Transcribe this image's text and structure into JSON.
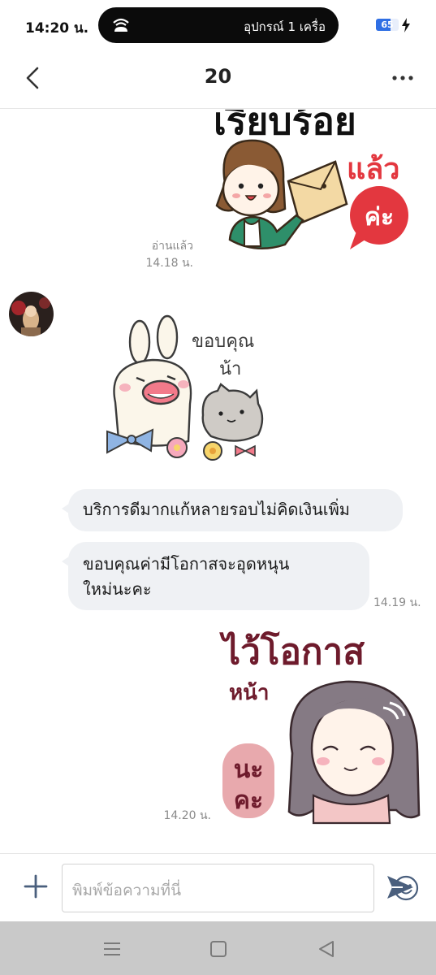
{
  "status_bar": {
    "time": "14:20 น.",
    "notification": "อุปกรณ์ 1 เครื่อ",
    "battery_level": "65",
    "battery_fraction": 0.65
  },
  "header": {
    "title": "20",
    "back_icon": "chevron-left-icon",
    "more_icon": "more-horizontal-icon"
  },
  "messages": [
    {
      "type": "sticker",
      "sender": "me",
      "sticker_text_lines": [
        "เรียบร้อย",
        "แล้ว",
        "ค่ะ"
      ],
      "status": "อ่านแล้ว",
      "time": "14.18 น."
    },
    {
      "type": "sticker",
      "sender": "other",
      "sticker_text_lines": [
        "ขอบคุณ",
        "น้า"
      ]
    },
    {
      "type": "text",
      "sender": "other",
      "text": "บริการดีมากแก้หลายรอบไม่คิดเงินเพิ่ม"
    },
    {
      "type": "text",
      "sender": "other",
      "lines": [
        "ขอบคุณค่ามีโอกาสจะอุดหนุน",
        "ใหม่นะคะ"
      ],
      "time": "14.19 น."
    },
    {
      "type": "sticker",
      "sender": "me",
      "sticker_text_lines": [
        "ไว้โอกาส",
        "หน้า",
        "นะ",
        "คะ"
      ],
      "time": "14.20 น."
    }
  ],
  "input": {
    "placeholder": "พิมพ์ข้อความที่นี่",
    "value": ""
  },
  "colors": {
    "bubble_bg": "#eff1f4",
    "battery_accent": "#2f6fe4",
    "send_icon": "#4a5f7d",
    "sticker_red": "#e3373f",
    "sticker_maroon": "#6e1b2c"
  }
}
